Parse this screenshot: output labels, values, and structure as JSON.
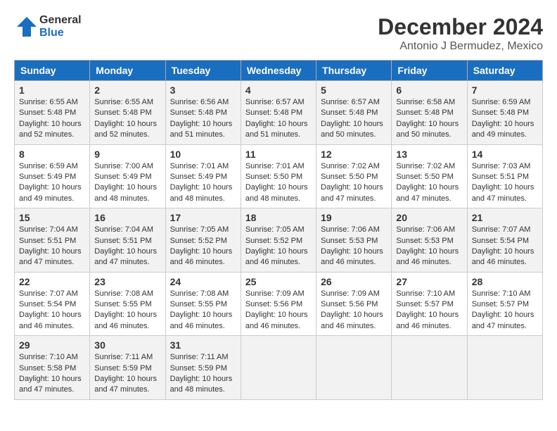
{
  "logo": {
    "line1": "General",
    "line2": "Blue"
  },
  "title": "December 2024",
  "location": "Antonio J Bermudez, Mexico",
  "days_of_week": [
    "Sunday",
    "Monday",
    "Tuesday",
    "Wednesday",
    "Thursday",
    "Friday",
    "Saturday"
  ],
  "weeks": [
    [
      {
        "day": "1",
        "info": "Sunrise: 6:55 AM\nSunset: 5:48 PM\nDaylight: 10 hours\nand 52 minutes."
      },
      {
        "day": "2",
        "info": "Sunrise: 6:55 AM\nSunset: 5:48 PM\nDaylight: 10 hours\nand 52 minutes."
      },
      {
        "day": "3",
        "info": "Sunrise: 6:56 AM\nSunset: 5:48 PM\nDaylight: 10 hours\nand 51 minutes."
      },
      {
        "day": "4",
        "info": "Sunrise: 6:57 AM\nSunset: 5:48 PM\nDaylight: 10 hours\nand 51 minutes."
      },
      {
        "day": "5",
        "info": "Sunrise: 6:57 AM\nSunset: 5:48 PM\nDaylight: 10 hours\nand 50 minutes."
      },
      {
        "day": "6",
        "info": "Sunrise: 6:58 AM\nSunset: 5:48 PM\nDaylight: 10 hours\nand 50 minutes."
      },
      {
        "day": "7",
        "info": "Sunrise: 6:59 AM\nSunset: 5:48 PM\nDaylight: 10 hours\nand 49 minutes."
      }
    ],
    [
      {
        "day": "8",
        "info": "Sunrise: 6:59 AM\nSunset: 5:49 PM\nDaylight: 10 hours\nand 49 minutes."
      },
      {
        "day": "9",
        "info": "Sunrise: 7:00 AM\nSunset: 5:49 PM\nDaylight: 10 hours\nand 48 minutes."
      },
      {
        "day": "10",
        "info": "Sunrise: 7:01 AM\nSunset: 5:49 PM\nDaylight: 10 hours\nand 48 minutes."
      },
      {
        "day": "11",
        "info": "Sunrise: 7:01 AM\nSunset: 5:50 PM\nDaylight: 10 hours\nand 48 minutes."
      },
      {
        "day": "12",
        "info": "Sunrise: 7:02 AM\nSunset: 5:50 PM\nDaylight: 10 hours\nand 47 minutes."
      },
      {
        "day": "13",
        "info": "Sunrise: 7:02 AM\nSunset: 5:50 PM\nDaylight: 10 hours\nand 47 minutes."
      },
      {
        "day": "14",
        "info": "Sunrise: 7:03 AM\nSunset: 5:51 PM\nDaylight: 10 hours\nand 47 minutes."
      }
    ],
    [
      {
        "day": "15",
        "info": "Sunrise: 7:04 AM\nSunset: 5:51 PM\nDaylight: 10 hours\nand 47 minutes."
      },
      {
        "day": "16",
        "info": "Sunrise: 7:04 AM\nSunset: 5:51 PM\nDaylight: 10 hours\nand 47 minutes."
      },
      {
        "day": "17",
        "info": "Sunrise: 7:05 AM\nSunset: 5:52 PM\nDaylight: 10 hours\nand 46 minutes."
      },
      {
        "day": "18",
        "info": "Sunrise: 7:05 AM\nSunset: 5:52 PM\nDaylight: 10 hours\nand 46 minutes."
      },
      {
        "day": "19",
        "info": "Sunrise: 7:06 AM\nSunset: 5:53 PM\nDaylight: 10 hours\nand 46 minutes."
      },
      {
        "day": "20",
        "info": "Sunrise: 7:06 AM\nSunset: 5:53 PM\nDaylight: 10 hours\nand 46 minutes."
      },
      {
        "day": "21",
        "info": "Sunrise: 7:07 AM\nSunset: 5:54 PM\nDaylight: 10 hours\nand 46 minutes."
      }
    ],
    [
      {
        "day": "22",
        "info": "Sunrise: 7:07 AM\nSunset: 5:54 PM\nDaylight: 10 hours\nand 46 minutes."
      },
      {
        "day": "23",
        "info": "Sunrise: 7:08 AM\nSunset: 5:55 PM\nDaylight: 10 hours\nand 46 minutes."
      },
      {
        "day": "24",
        "info": "Sunrise: 7:08 AM\nSunset: 5:55 PM\nDaylight: 10 hours\nand 46 minutes."
      },
      {
        "day": "25",
        "info": "Sunrise: 7:09 AM\nSunset: 5:56 PM\nDaylight: 10 hours\nand 46 minutes."
      },
      {
        "day": "26",
        "info": "Sunrise: 7:09 AM\nSunset: 5:56 PM\nDaylight: 10 hours\nand 46 minutes."
      },
      {
        "day": "27",
        "info": "Sunrise: 7:10 AM\nSunset: 5:57 PM\nDaylight: 10 hours\nand 46 minutes."
      },
      {
        "day": "28",
        "info": "Sunrise: 7:10 AM\nSunset: 5:57 PM\nDaylight: 10 hours\nand 47 minutes."
      }
    ],
    [
      {
        "day": "29",
        "info": "Sunrise: 7:10 AM\nSunset: 5:58 PM\nDaylight: 10 hours\nand 47 minutes."
      },
      {
        "day": "30",
        "info": "Sunrise: 7:11 AM\nSunset: 5:59 PM\nDaylight: 10 hours\nand 47 minutes."
      },
      {
        "day": "31",
        "info": "Sunrise: 7:11 AM\nSunset: 5:59 PM\nDaylight: 10 hours\nand 48 minutes."
      },
      {
        "day": "",
        "info": ""
      },
      {
        "day": "",
        "info": ""
      },
      {
        "day": "",
        "info": ""
      },
      {
        "day": "",
        "info": ""
      }
    ]
  ]
}
